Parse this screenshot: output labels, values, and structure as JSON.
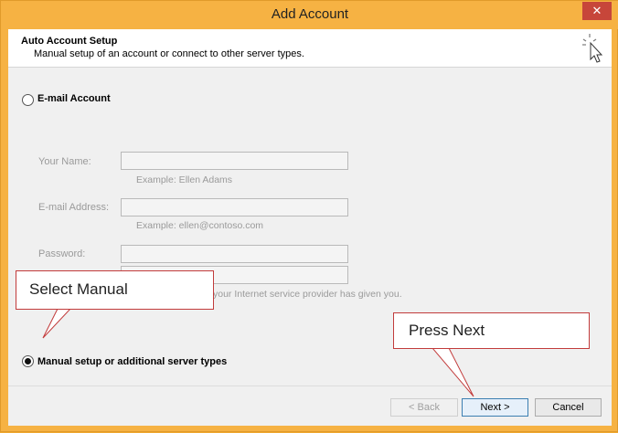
{
  "window": {
    "title": "Add Account",
    "close_label": "✕"
  },
  "header": {
    "title": "Auto Account Setup",
    "subtitle": "Manual setup of an account or connect to other server types."
  },
  "email_option": {
    "label": "E-mail Account"
  },
  "fields": {
    "name_label": "Your Name:",
    "name_example": "Example: Ellen Adams",
    "email_label": "E-mail Address:",
    "email_example": "Example: ellen@contoso.com",
    "password_label": "Password:",
    "password_hint": "your Internet service provider has given you."
  },
  "manual_option": {
    "label": "Manual setup or additional server types"
  },
  "buttons": {
    "back": "< Back",
    "next": "Next >",
    "cancel": "Cancel"
  },
  "annotations": {
    "select_manual": "Select Manual",
    "press_next": "Press Next"
  },
  "colors": {
    "title_bar": "#f6b243",
    "callout_border": "#c23b3b"
  }
}
